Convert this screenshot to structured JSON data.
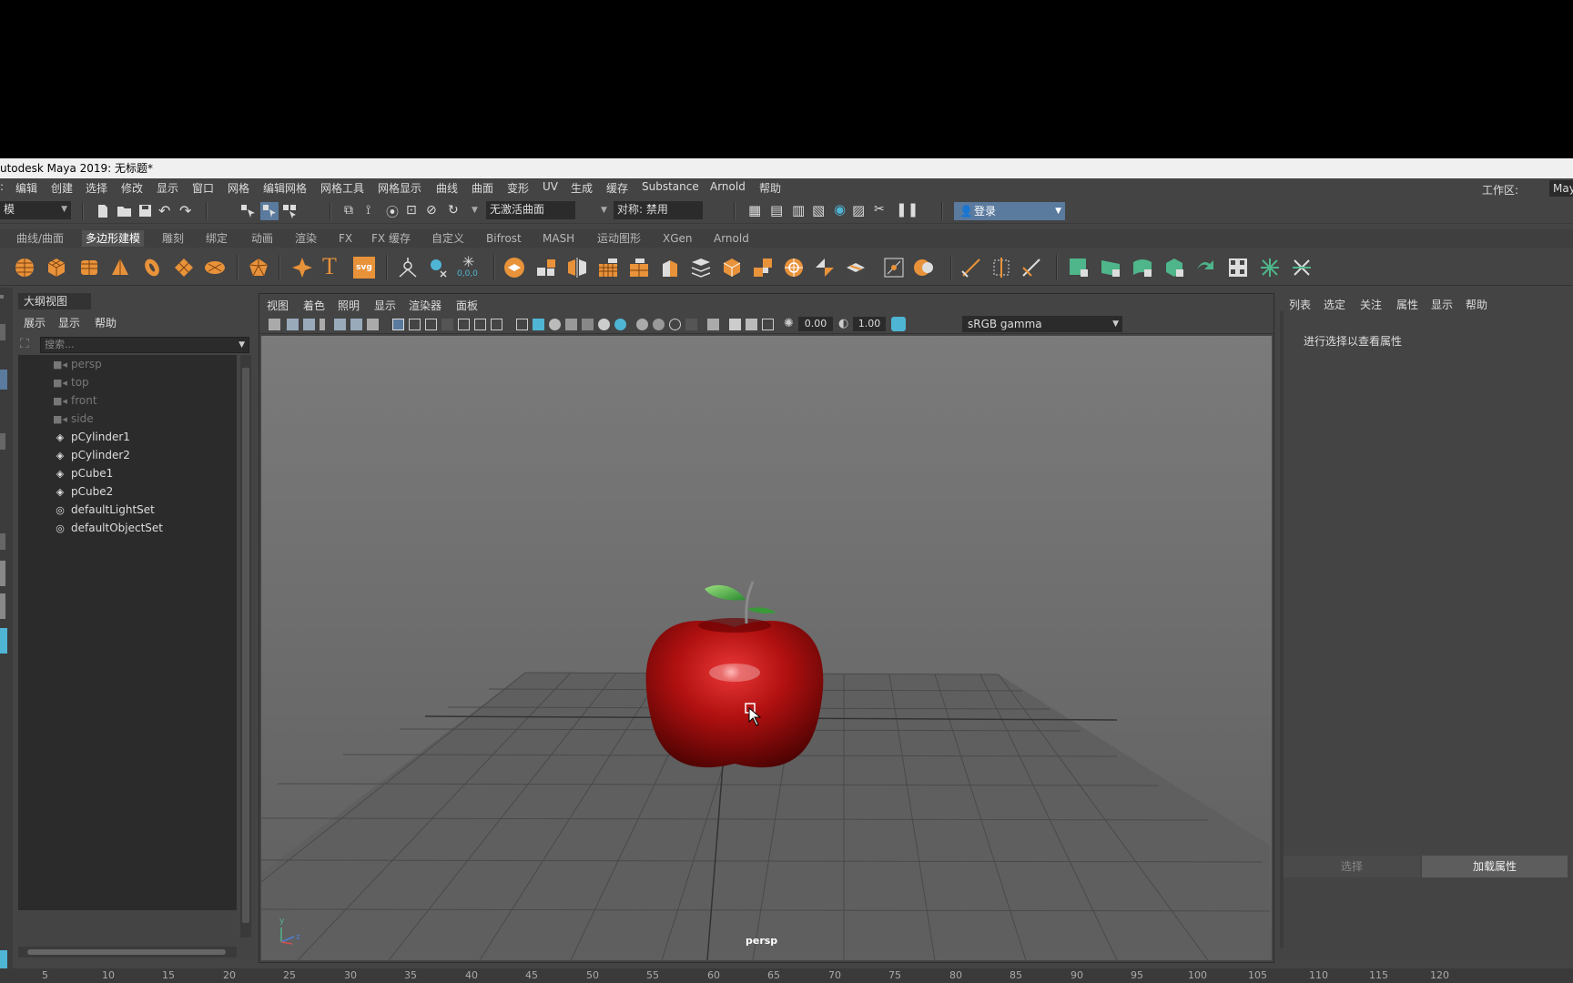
{
  "title_bar": {
    "text": "utodesk Maya 2019: 无标题*"
  },
  "menu": {
    "items": [
      "编辑",
      "创建",
      "选择",
      "修改",
      "显示",
      "窗口",
      "网格",
      "编辑网格",
      "网格工具",
      "网格显示",
      "曲线",
      "曲面",
      "变形",
      "UV",
      "生成",
      "缓存",
      "Substance",
      "Arnold",
      "帮助"
    ],
    "workspace_label": "工作区:",
    "workspace_value": "Maya"
  },
  "status_line": {
    "mode_value": "模",
    "live_surface": "无激活曲面",
    "symmetry": "对称: 禁用",
    "login": "登录"
  },
  "shelf": {
    "tabs": [
      "曲线/曲面",
      "多边形建模",
      "雕刻",
      "绑定",
      "动画",
      "渲染",
      "FX",
      "FX 缓存",
      "自定义",
      "Bifrost",
      "MASH",
      "运动图形",
      "XGen",
      "Arnold"
    ],
    "active_tab_index": 1,
    "svg_label": "svg",
    "coord_label": "0,0,0"
  },
  "outliner": {
    "tab": "大纲视图",
    "menus": [
      "展示",
      "显示",
      "帮助"
    ],
    "search_placeholder": "搜索...",
    "items": [
      {
        "name": "persp",
        "icon": "camera-icon",
        "dim": true
      },
      {
        "name": "top",
        "icon": "camera-icon",
        "dim": true
      },
      {
        "name": "front",
        "icon": "camera-icon",
        "dim": true
      },
      {
        "name": "side",
        "icon": "camera-icon",
        "dim": true
      },
      {
        "name": "pCylinder1",
        "icon": "mesh-icon",
        "dim": false
      },
      {
        "name": "pCylinder2",
        "icon": "mesh-icon",
        "dim": false
      },
      {
        "name": "pCube1",
        "icon": "mesh-icon",
        "dim": false
      },
      {
        "name": "pCube2",
        "icon": "mesh-icon",
        "dim": false
      },
      {
        "name": "defaultLightSet",
        "icon": "set-icon",
        "dim": false
      },
      {
        "name": "defaultObjectSet",
        "icon": "set-icon",
        "dim": false
      }
    ]
  },
  "viewport": {
    "menus": [
      "视图",
      "着色",
      "照明",
      "显示",
      "渲染器",
      "面板"
    ],
    "exposure": "0.00",
    "gamma": "1.00",
    "color_space": "sRGB gamma",
    "camera_label": "persp",
    "axis_y": "y",
    "axis_z": "z"
  },
  "attribute_editor": {
    "menus": [
      "列表",
      "选定",
      "关注",
      "属性",
      "显示",
      "帮助"
    ],
    "hint": "进行选择以查看属性",
    "select_button": "选择",
    "load_button": "加载属性"
  },
  "timeline": {
    "ticks": [
      "5",
      "10",
      "15",
      "20",
      "25",
      "30",
      "35",
      "40",
      "45",
      "50",
      "55",
      "60",
      "65",
      "70",
      "75",
      "80",
      "85",
      "90",
      "95",
      "100",
      "105",
      "110",
      "115",
      "120"
    ]
  },
  "colors": {
    "accent_orange": "#e8923a",
    "accent_green": "#4fb58a",
    "selection_blue": "#5a7a9e",
    "apple_red": "#b01010"
  }
}
